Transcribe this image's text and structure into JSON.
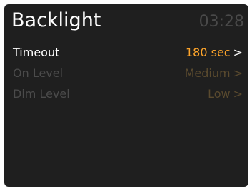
{
  "header": {
    "title": "Backlight",
    "clock": "03:28"
  },
  "menu": {
    "items": [
      {
        "label": "Timeout",
        "value": "180 sec",
        "chevron": ">",
        "selected": true
      },
      {
        "label": "On Level",
        "value": "Medium",
        "chevron": ">",
        "selected": false
      },
      {
        "label": "Dim Level",
        "value": "Low",
        "chevron": ">",
        "selected": false
      }
    ]
  },
  "colors": {
    "background": "#1f1f1f",
    "title_text": "#ffffff",
    "clock_text": "#4a4a4a",
    "selected_value": "#ffa52a",
    "inactive_label": "#4b4b4b",
    "inactive_value": "#5a4a2e"
  }
}
